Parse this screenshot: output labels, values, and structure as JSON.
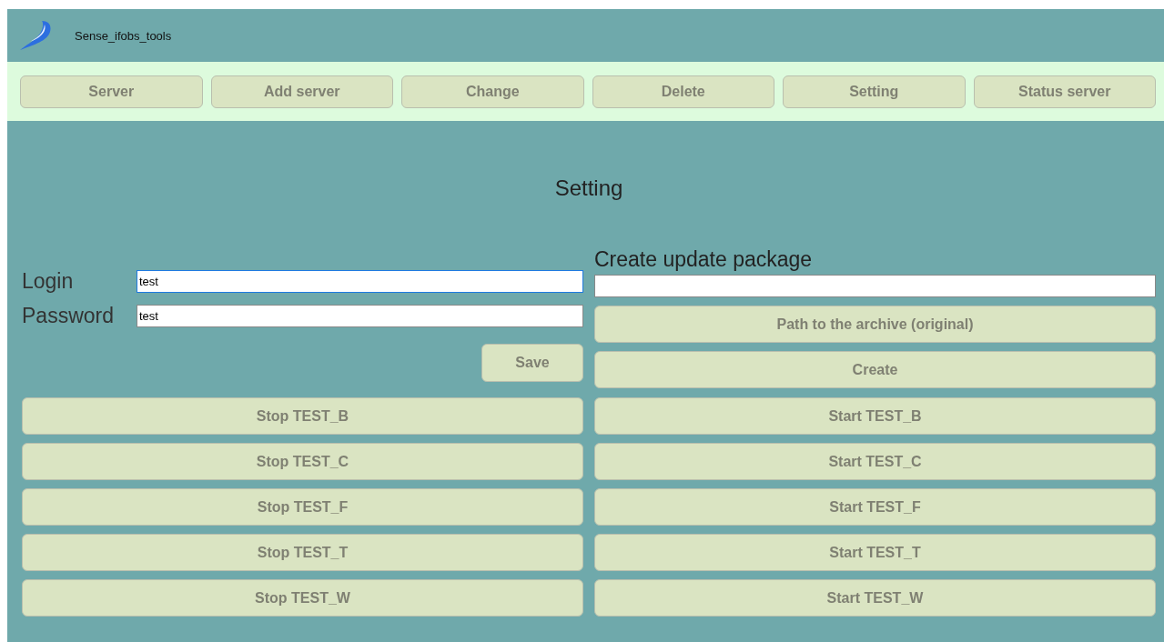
{
  "app": {
    "title": "Sense_ifobs_tools"
  },
  "nav": [
    "Server",
    "Add server",
    "Change",
    "Delete",
    "Setting",
    "Status server"
  ],
  "page_title": "Setting",
  "fields": [
    {
      "label": "Login",
      "value": "test",
      "focused": true
    },
    {
      "label": "Password",
      "value": "test",
      "focused": false
    }
  ],
  "save_button": "Save",
  "update_package": {
    "heading": "Create update package",
    "buttons": [
      "Path to the archive (original)",
      "Create"
    ]
  },
  "services": [
    {
      "stop": "Stop TEST_B",
      "start": "Start TEST_B"
    },
    {
      "stop": "Stop TEST_C",
      "start": "Start TEST_C"
    },
    {
      "stop": "Stop TEST_F",
      "start": "Start TEST_F"
    },
    {
      "stop": "Stop TEST_T",
      "start": "Start TEST_T"
    },
    {
      "stop": "Stop TEST_W",
      "start": "Start TEST_W"
    }
  ]
}
